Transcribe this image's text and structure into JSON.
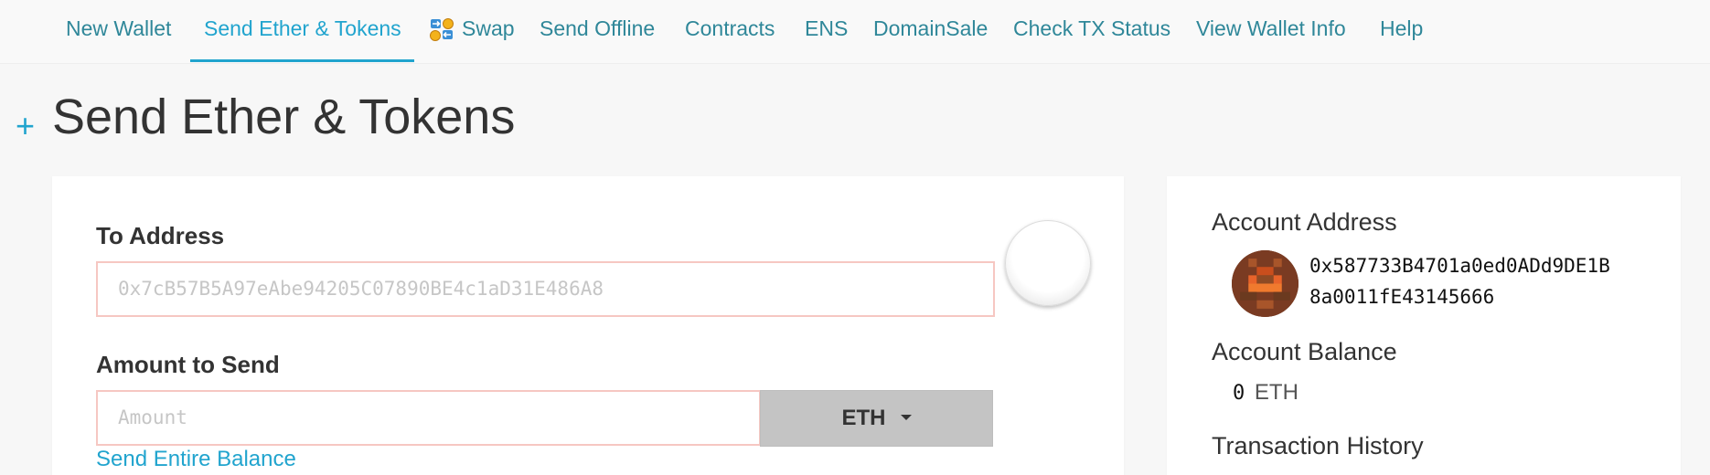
{
  "nav": {
    "items": [
      {
        "label": "New Wallet"
      },
      {
        "label": "Send Ether & Tokens",
        "active": true
      },
      {
        "label": "Swap",
        "icon": "swap-icon"
      },
      {
        "label": "Send Offline"
      },
      {
        "label": "Contracts"
      },
      {
        "label": "ENS"
      },
      {
        "label": "DomainSale"
      },
      {
        "label": "Check TX Status"
      },
      {
        "label": "View Wallet Info"
      },
      {
        "label": "Help"
      }
    ]
  },
  "page": {
    "plus_icon": "+",
    "title": "Send Ether & Tokens"
  },
  "form": {
    "to_address_label": "To Address",
    "to_address_placeholder": "0x7cB57B5A97eAbe94205C07890BE4c1aD31E486A8",
    "amount_label": "Amount to Send",
    "amount_placeholder": "Amount",
    "currency": "ETH",
    "send_entire_balance": "Send Entire Balance"
  },
  "account": {
    "address_heading": "Account Address",
    "address_line1": "0x587733B4701a0ed0ADd9DE1B",
    "address_line2": "8a0011fE43145666",
    "balance_heading": "Account Balance",
    "balance_value": "0",
    "balance_unit": "ETH",
    "history_heading": "Transaction History"
  },
  "colors": {
    "accent": "#21a4ce",
    "nav_text": "#2f8799",
    "input_error_border": "#f6c7c2",
    "currency_button": "#c4c4c4"
  }
}
